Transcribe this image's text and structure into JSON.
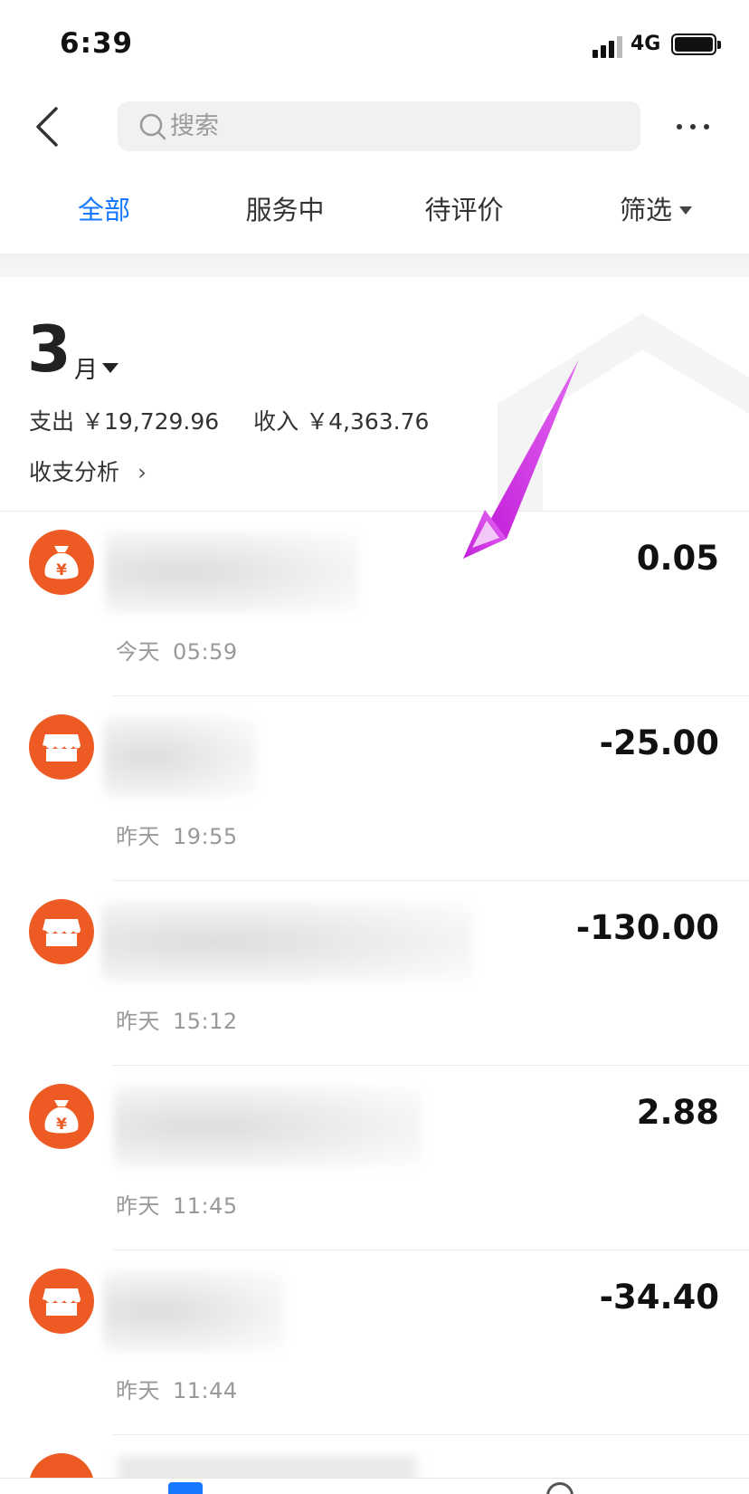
{
  "status_bar": {
    "time": "6:39",
    "network": "4G"
  },
  "header": {
    "back_icon": "chevron-left-icon",
    "search_placeholder": "搜索",
    "more_icon": "more-horizontal-icon"
  },
  "tabs": [
    {
      "label": "全部",
      "active": true
    },
    {
      "label": "服务中",
      "active": false
    },
    {
      "label": "待评价",
      "active": false
    },
    {
      "label": "筛选",
      "active": false,
      "has_dropdown": true
    }
  ],
  "summary": {
    "month_number": "3",
    "month_unit": "月",
    "expense": "支出 ￥19,729.96",
    "income": "收入 ￥4,363.76",
    "analysis_label": "收支分析",
    "analysis_arrow": "›"
  },
  "transactions": [
    {
      "icon": "money-bag-icon",
      "amount": "0.05",
      "day": "今天",
      "time": "05:59"
    },
    {
      "icon": "shop-icon",
      "amount": "-25.00",
      "day": "昨天",
      "time": "19:55"
    },
    {
      "icon": "shop-icon",
      "amount": "-130.00",
      "day": "昨天",
      "time": "15:12"
    },
    {
      "icon": "money-bag-icon",
      "amount": "2.88",
      "day": "昨天",
      "time": "11:45"
    },
    {
      "icon": "shop-icon",
      "amount": "-34.40",
      "day": "昨天",
      "time": "11:44"
    }
  ],
  "colors": {
    "accent": "#1677ff",
    "icon_bg": "#ee5a24",
    "annotation_arrow": "#d63ae8"
  }
}
